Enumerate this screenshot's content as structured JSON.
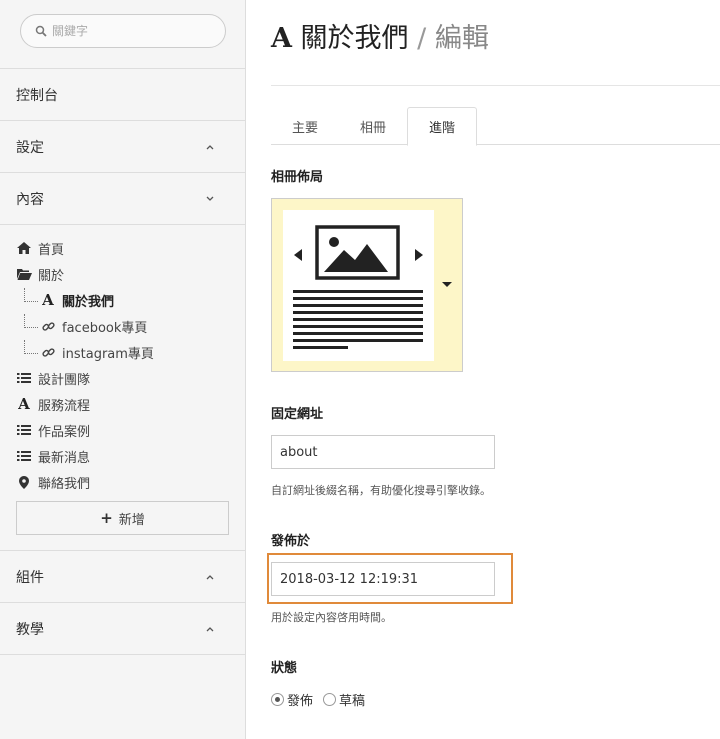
{
  "sidebar": {
    "search_placeholder": "關鍵字",
    "sections": {
      "dashboard": "控制台",
      "settings": "設定",
      "content": "內容",
      "components": "組件",
      "tutorial": "教學"
    },
    "tree": {
      "home": "首頁",
      "about": "關於",
      "about_us": "關於我們",
      "facebook": "facebook專頁",
      "instagram": "instagram專頁",
      "design_team": "設計團隊",
      "service_flow": "服務流程",
      "portfolio": "作品案例",
      "news": "最新消息",
      "contact": "聯絡我們"
    },
    "add_label": "新增"
  },
  "main": {
    "title": {
      "icon": "A",
      "page": "關於我們",
      "sep": "/",
      "action": "編輯"
    },
    "tabs": [
      "主要",
      "相冊",
      "進階"
    ],
    "active_tab": "進階",
    "album_layout": {
      "label": "相冊佈局"
    },
    "slug": {
      "label": "固定網址",
      "value": "about",
      "help": "自訂網址後綴名稱，有助優化搜尋引擎收錄。"
    },
    "publish_at": {
      "label": "發佈於",
      "value": "2018-03-12 12:19:31",
      "help": "用於設定內容啓用時間。"
    },
    "status": {
      "label": "狀態",
      "options": [
        "發佈",
        "草稿"
      ],
      "selected": "發佈"
    }
  },
  "colors": {
    "highlight": "#e08a3a",
    "layout_bg": "#fdf6c8",
    "sidebar_bg": "#f5f5f5"
  }
}
